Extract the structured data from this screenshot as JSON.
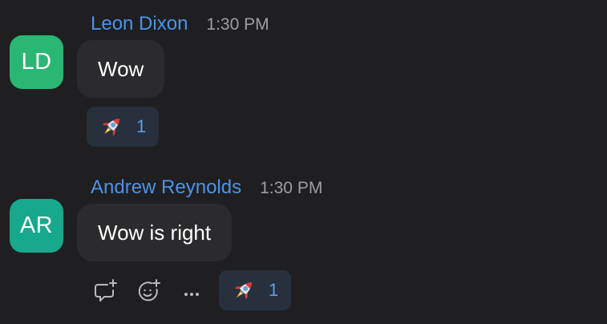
{
  "messages": [
    {
      "avatar_initials": "LD",
      "avatar_color": "#2ab673",
      "sender": "Leon Dixon",
      "time": "1:30 PM",
      "text": "Wow",
      "reaction": {
        "icon": "rocket-icon",
        "count": "1"
      }
    },
    {
      "avatar_initials": "AR",
      "avatar_color": "#17a98c",
      "sender": "Andrew Reynolds",
      "time": "1:30 PM",
      "text": "Wow is right",
      "reaction": {
        "icon": "rocket-icon",
        "count": "1"
      }
    }
  ],
  "hover_actions": [
    "reply-in-thread-icon",
    "add-reaction-icon",
    "more-options-icon"
  ],
  "colors": {
    "background": "#1f1f21",
    "bubble": "#2b2b2d",
    "sender_name": "#4c93e6",
    "timestamp": "#9d9da2",
    "reaction_pill": "#27303c",
    "reaction_count": "#5aa0ec"
  }
}
